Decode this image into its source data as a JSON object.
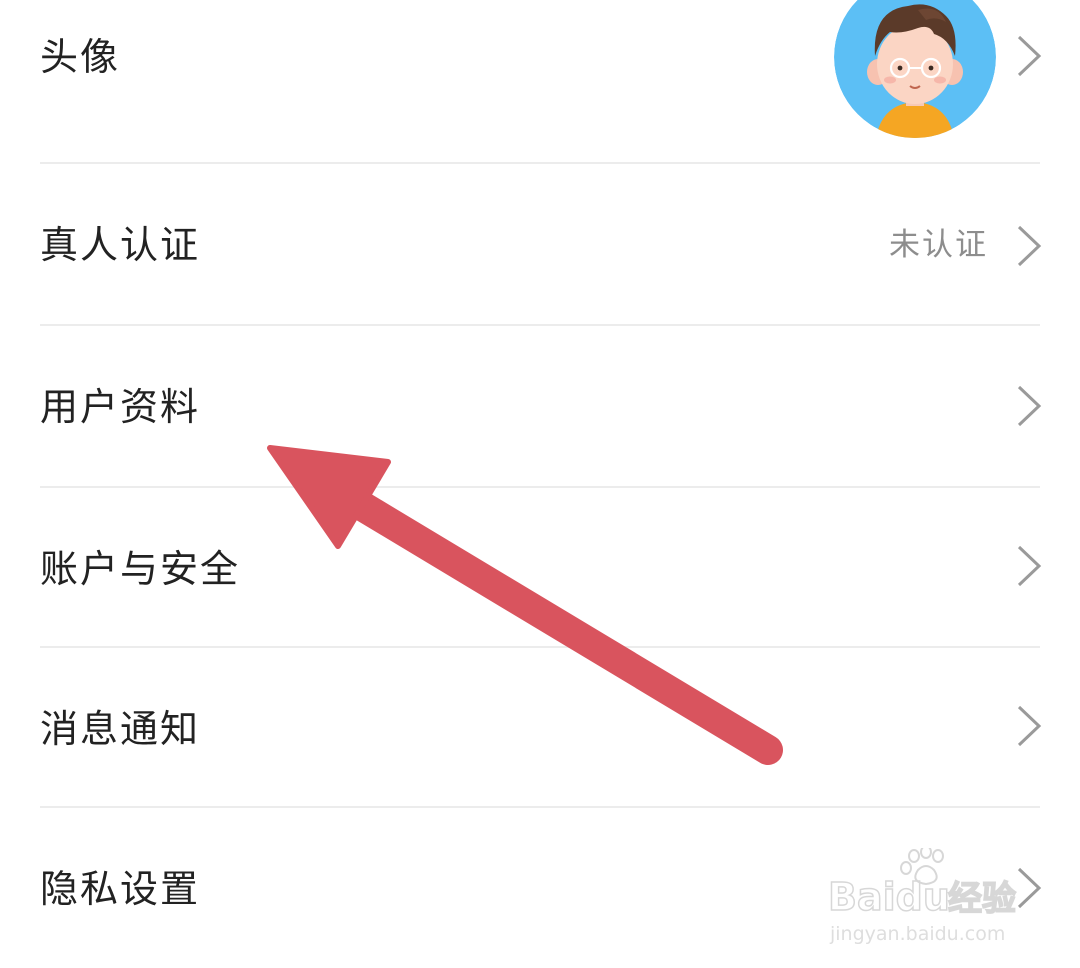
{
  "settings": {
    "rows": [
      {
        "label": "头像",
        "value": "",
        "icon": "chevron-right-icon"
      },
      {
        "label": "真人认证",
        "value": "未认证",
        "icon": "chevron-right-icon"
      },
      {
        "label": "用户资料",
        "value": "",
        "icon": "chevron-right-icon"
      },
      {
        "label": "账户与安全",
        "value": "",
        "icon": "chevron-right-icon"
      },
      {
        "label": "消息通知",
        "value": "",
        "icon": "chevron-right-icon"
      },
      {
        "label": "隐私设置",
        "value": "",
        "icon": "chevron-right-icon"
      }
    ]
  },
  "annotation": {
    "arrow_color": "#d9545e",
    "points_to": "用户资料"
  },
  "watermark": {
    "brand": "Baidu",
    "brand_suffix": "经验",
    "url": "jingyan.baidu.com"
  },
  "colors": {
    "label_text": "#222222",
    "value_text": "#8d8d8d",
    "chevron": "#9a9a9a",
    "divider": "#ececec",
    "avatar_bg": "#5cbff5"
  }
}
